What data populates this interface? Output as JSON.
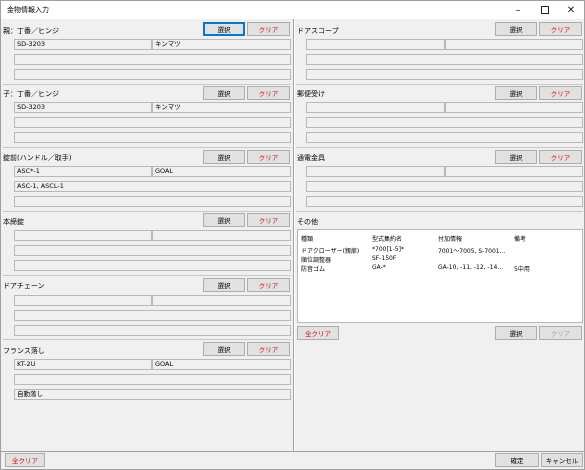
{
  "window": {
    "title": "金物情報入力"
  },
  "buttons": {
    "select": "選択",
    "clear": "クリア",
    "clear_all": "全クリア",
    "ok": "確定",
    "cancel": "キャンセル"
  },
  "left": {
    "oya": {
      "label": "親：丁番／ヒンジ",
      "f1": "SD-3203",
      "f2": "キンマツ",
      "f3": "",
      "f4": ""
    },
    "ko": {
      "label": "子：丁番／ヒンジ",
      "f1": "SD-3203",
      "f2": "キンマツ",
      "f3": "",
      "f4": ""
    },
    "lock": {
      "label": "錠前(ハンドル／取手)",
      "f1": "ASC*-1",
      "f2": "GOAL",
      "f3": "ASC-1, ASCL-1",
      "f4": ""
    },
    "bolt": {
      "label": "本締錠",
      "f1": "",
      "f2": "",
      "f3": "",
      "f4": ""
    },
    "chain": {
      "label": "ドアチェーン",
      "f1": "",
      "f2": "",
      "f3": "",
      "f4": ""
    },
    "flush": {
      "label": "フランス落し",
      "f1": "KT-2U",
      "f2": "GOAL",
      "f3": "",
      "f4": "自動落し"
    }
  },
  "right": {
    "scope": {
      "label": "ドアスコープ",
      "f1": "",
      "f2": "",
      "f3": "",
      "f4": ""
    },
    "post": {
      "label": "郵便受け",
      "f1": "",
      "f2": "",
      "f3": "",
      "f4": ""
    },
    "elec": {
      "label": "通電金具",
      "f1": "",
      "f2": "",
      "f3": "",
      "f4": ""
    },
    "other": {
      "label": "その他"
    }
  },
  "other_table": {
    "headers": [
      "種類",
      "型式集約名",
      "付加情報",
      "備考"
    ],
    "rows": [
      [
        "ドアクローザー(親扉)",
        "*700[1-5]*",
        "7001～7005, S-7001…",
        ""
      ],
      [
        "順位調整器",
        "SF-150F",
        "",
        ""
      ],
      [
        "防音ゴム",
        "GA-*",
        "GA-10, -11, -12, -14…",
        "5中用"
      ]
    ]
  }
}
